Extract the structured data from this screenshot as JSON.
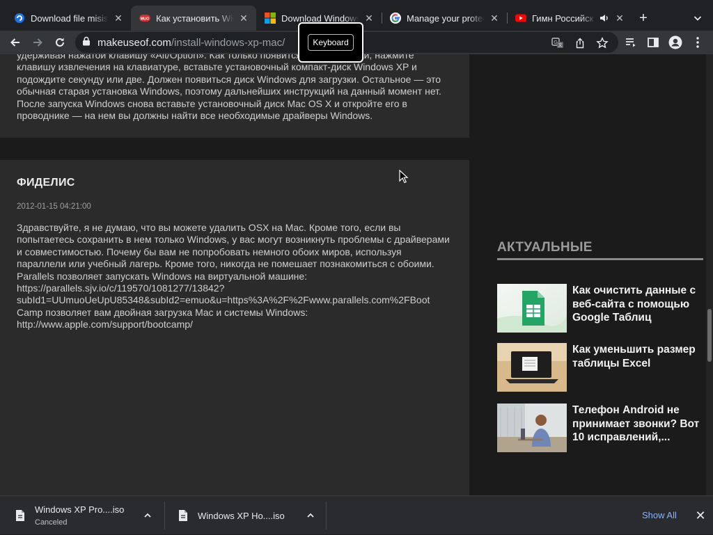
{
  "tabs": [
    {
      "label": "Download file misis y",
      "icon": "blue-swirl-icon",
      "active": false
    },
    {
      "label": "Как установить Win",
      "icon": "muo-logo-icon",
      "active": true
    },
    {
      "label": "Download Windows",
      "icon": "windows-logo-icon",
      "active": false
    },
    {
      "label": "Manage your protec",
      "icon": "google-icon",
      "active": false
    },
    {
      "label": "Гимн Российск",
      "icon": "youtube-icon",
      "active": false,
      "audio": true
    }
  ],
  "toolbar": {
    "url_host": "makeuseof.com",
    "url_path": "/install-windows-xp-mac/",
    "tooltip": "Keyboard"
  },
  "article": {
    "prev_comment_text": "удерживая нажатой клавишу «Alt/Option». Как только появится меню загрузки, нажмите клавишу извлечения на клавиатуре, вставьте установочный компакт-диск Windows XP и подождите секунду или две. Должен появиться диск Windows для загрузки. Остальное — это обычная старая установка Windows, поэтому дальнейших инструкций на данный момент нет. После запуска Windows снова вставьте установочный диск Mac OS X и откройте его в проводнике — на нем вы должны найти все необходимые драйверы Windows.",
    "comment": {
      "author": "ФИДЕЛИС",
      "date": "2012-01-15 04:21:00",
      "text": "Здравствуйте, я не думаю, что вы можете удалить OSX на Mac. Кроме того, если вы попытаетесь сохранить в нем только Windows, у вас могут возникнуть проблемы с драйверами и совместимостью. Почему бы вам не попробовать немного обоих миров, используя параллели или учебный лагерь. Кроме того, никогда не помешает познакомиться с обоими. Parallels позволяет запускать Windows на виртуальной машине: https://parallels.sjv.io/c/119570/1081277/13842?subId1=UUmuoUeUpU85348&subId2=emuo&u=https%3A%2F%2Fwww.parallels.com%2FBoot Camp позволяет вам двойная загрузка Mac и системы Windows: http://www.apple.com/support/bootcamp/"
    }
  },
  "sidebar": {
    "title": "АКТУАЛЬНЫЕ",
    "items": [
      {
        "title": "Как очистить данные с веб-сайта с помощью Google Таблиц",
        "thumb": "google-sheets-thumbnail"
      },
      {
        "title": "Как уменьшить размер таблицы Excel",
        "thumb": "laptop-thumbnail"
      },
      {
        "title": "Телефон Android не принимает звонки? Вот 10 исправлений,...",
        "thumb": "man-on-phone-thumbnail"
      }
    ]
  },
  "downloads": {
    "items": [
      {
        "name": "Windows XP Pro....iso",
        "status": "Canceled"
      },
      {
        "name": "Windows XP Ho....iso",
        "status": ""
      }
    ],
    "show_all": "Show All"
  }
}
